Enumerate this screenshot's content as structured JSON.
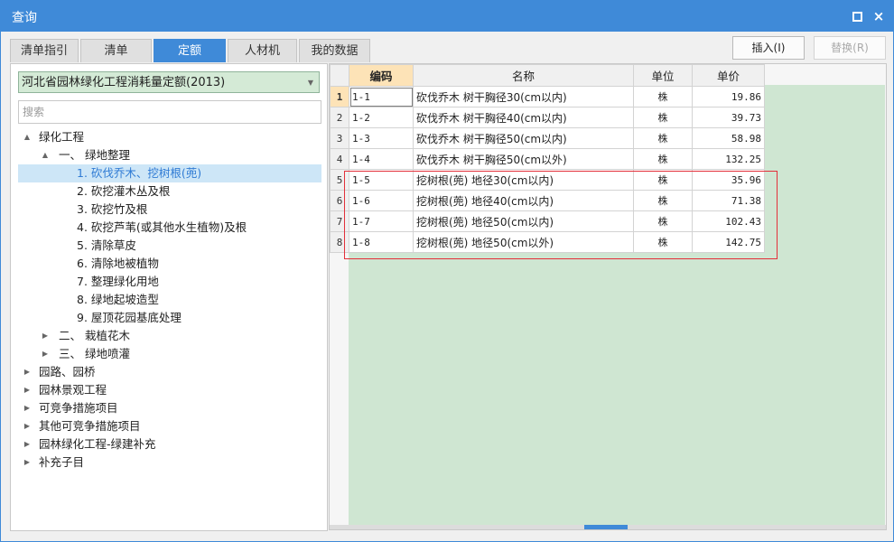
{
  "window": {
    "title": "查询",
    "maximize_icon": "maximize-icon",
    "close_label": "×"
  },
  "tabs": [
    {
      "label": "清单指引",
      "active": false
    },
    {
      "label": "清单",
      "active": false
    },
    {
      "label": "定额",
      "active": true
    },
    {
      "label": "人材机",
      "active": false
    },
    {
      "label": "我的数据",
      "active": false
    }
  ],
  "toolbar": {
    "insert_label": "插入(I)",
    "replace_label": "替换(R)"
  },
  "library": {
    "selected": "河北省园林绿化工程消耗量定额(2013)"
  },
  "search": {
    "placeholder": "搜索",
    "value": ""
  },
  "tree": [
    {
      "label": "绿化工程",
      "toggle": "▲",
      "level": 0
    },
    {
      "label": "一、 绿地整理",
      "toggle": "▲",
      "level": 1
    },
    {
      "label": "1. 砍伐乔木、挖树根(蔸)",
      "toggle": "",
      "level": 2,
      "selected": true
    },
    {
      "label": "2. 砍挖灌木丛及根",
      "toggle": "",
      "level": 2
    },
    {
      "label": "3. 砍挖竹及根",
      "toggle": "",
      "level": 2
    },
    {
      "label": "4. 砍挖芦苇(或其他水生植物)及根",
      "toggle": "",
      "level": 2
    },
    {
      "label": "5. 清除草皮",
      "toggle": "",
      "level": 2
    },
    {
      "label": "6. 清除地被植物",
      "toggle": "",
      "level": 2
    },
    {
      "label": "7. 整理绿化用地",
      "toggle": "",
      "level": 2
    },
    {
      "label": "8. 绿地起坡造型",
      "toggle": "",
      "level": 2
    },
    {
      "label": "9. 屋顶花园基底处理",
      "toggle": "",
      "level": 2
    },
    {
      "label": "二、 栽植花木",
      "toggle": "▶",
      "level": 1
    },
    {
      "label": "三、 绿地喷灌",
      "toggle": "▶",
      "level": 1
    },
    {
      "label": "园路、园桥",
      "toggle": "▶",
      "level": 0
    },
    {
      "label": "园林景观工程",
      "toggle": "▶",
      "level": 0
    },
    {
      "label": "可竞争措施项目",
      "toggle": "▶",
      "level": 0
    },
    {
      "label": "其他可竞争措施项目",
      "toggle": "▶",
      "level": 0
    },
    {
      "label": "园林绿化工程-绿建补充",
      "toggle": "▶",
      "level": 0
    },
    {
      "label": "补充子目",
      "toggle": "▶",
      "level": 0
    }
  ],
  "grid": {
    "columns": [
      "编码",
      "名称",
      "单位",
      "单价"
    ],
    "rows": [
      {
        "num": "1",
        "code": "1-1",
        "name": "砍伐乔木 树干胸径30(cm以内)",
        "unit": "株",
        "price": "19.86"
      },
      {
        "num": "2",
        "code": "1-2",
        "name": "砍伐乔木 树干胸径40(cm以内)",
        "unit": "株",
        "price": "39.73"
      },
      {
        "num": "3",
        "code": "1-3",
        "name": "砍伐乔木 树干胸径50(cm以内)",
        "unit": "株",
        "price": "58.98"
      },
      {
        "num": "4",
        "code": "1-4",
        "name": "砍伐乔木 树干胸径50(cm以外)",
        "unit": "株",
        "price": "132.25"
      },
      {
        "num": "5",
        "code": "1-5",
        "name": "挖树根(蔸) 地径30(cm以内)",
        "unit": "株",
        "price": "35.96"
      },
      {
        "num": "6",
        "code": "1-6",
        "name": "挖树根(蔸) 地径40(cm以内)",
        "unit": "株",
        "price": "71.38"
      },
      {
        "num": "7",
        "code": "1-7",
        "name": "挖树根(蔸) 地径50(cm以内)",
        "unit": "株",
        "price": "102.43"
      },
      {
        "num": "8",
        "code": "1-8",
        "name": "挖树根(蔸) 地径50(cm以外)",
        "unit": "株",
        "price": "142.75"
      }
    ]
  },
  "colors": {
    "accent": "#3f8ad8",
    "green_bg": "#cfe6d2",
    "highlight": "#e3303a",
    "selected_header": "#fde3b7"
  }
}
